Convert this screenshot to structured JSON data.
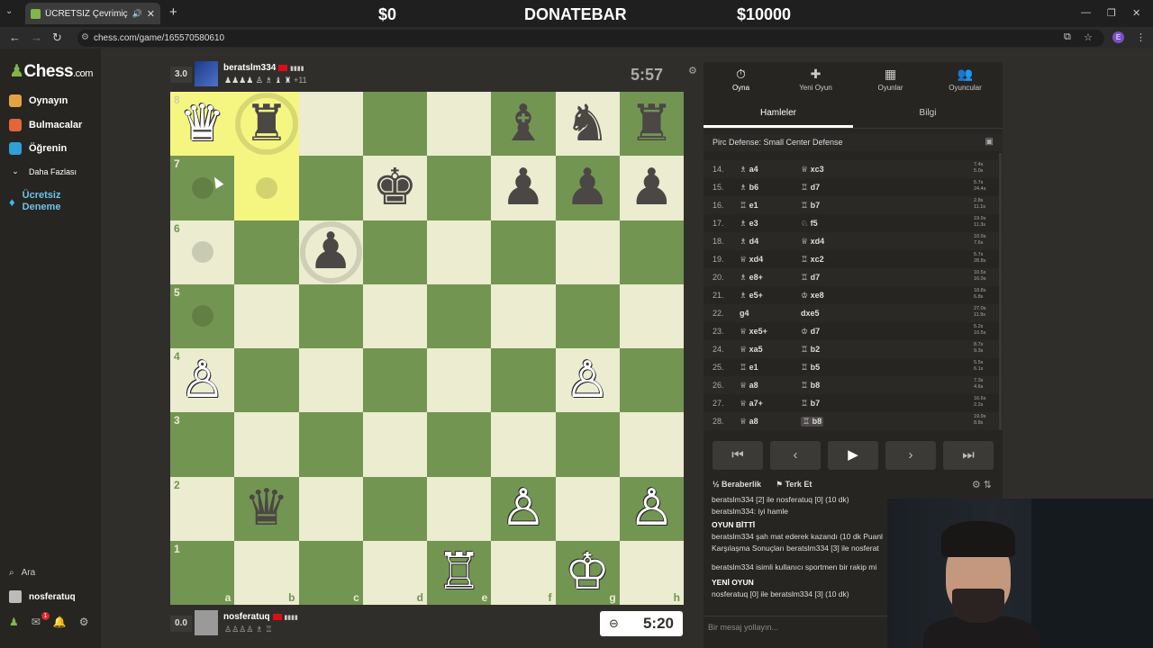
{
  "browser": {
    "tab_title": "ÜCRETSİZ Çevrimiçi Satranç",
    "url": "chess.com/game/165570580610",
    "donate_left": "$0",
    "donate_center": "DONATEBAR",
    "donate_right": "$10000",
    "profile_initial": "E"
  },
  "sidebar": {
    "logo": "Chess",
    "logo_suffix": ".com",
    "items": [
      {
        "label": "Oynayın",
        "color": "#e3a343"
      },
      {
        "label": "Bulmacalar",
        "color": "#e0673b"
      },
      {
        "label": "Öğrenin",
        "color": "#2f9fd8"
      }
    ],
    "more": "Daha Fazlası",
    "trial": "Ücretsiz Deneme",
    "search": "Ara",
    "username": "nosferatuq",
    "notifications": "1"
  },
  "top_player": {
    "score": "3.0",
    "name": "beratslm334",
    "status": "▮▮▮▮",
    "captured": "♟♟♟♟ ♙ ♗ ♝ ♜",
    "advantage": "+11",
    "clock": "5:57"
  },
  "bottom_player": {
    "score": "0.0",
    "name": "nosferatuq",
    "status": "▮▮▮▮",
    "captured": "♙♙♙♙ ♗ ♖",
    "clock": "5:20"
  },
  "board": {
    "ranks": [
      "8",
      "7",
      "6",
      "5",
      "4",
      "3",
      "2",
      "1"
    ],
    "files": [
      "a",
      "b",
      "c",
      "d",
      "e",
      "f",
      "g",
      "h"
    ],
    "rows": [
      [
        {
          "p": "♛",
          "c": "w",
          "hl": true
        },
        {
          "p": "♜",
          "c": "b",
          "hl": true,
          "ring": true
        },
        {},
        {},
        {},
        {
          "p": "♝",
          "c": "b"
        },
        {
          "p": "♞",
          "c": "b"
        },
        {
          "p": "♜",
          "c": "b"
        }
      ],
      [
        {
          "hint": true
        },
        {
          "hl": true,
          "hint": true
        },
        {},
        {
          "p": "♚",
          "c": "b"
        },
        {},
        {
          "p": "♟",
          "c": "b"
        },
        {
          "p": "♟",
          "c": "b"
        },
        {
          "p": "♟",
          "c": "b"
        }
      ],
      [
        {
          "hint": true
        },
        {},
        {
          "p": "♟",
          "c": "b",
          "ring": true
        },
        {},
        {},
        {},
        {},
        {}
      ],
      [
        {
          "hint": true
        },
        {},
        {},
        {},
        {},
        {},
        {},
        {}
      ],
      [
        {
          "p": "♙",
          "c": "w"
        },
        {},
        {},
        {},
        {},
        {},
        {
          "p": "♙",
          "c": "w"
        },
        {}
      ],
      [
        {},
        {},
        {},
        {},
        {},
        {},
        {},
        {}
      ],
      [
        {},
        {
          "p": "♛",
          "c": "b"
        },
        {},
        {},
        {},
        {
          "p": "♙",
          "c": "w"
        },
        {},
        {
          "p": "♙",
          "c": "w"
        }
      ],
      [
        {},
        {},
        {},
        {},
        {
          "p": "♖",
          "c": "w"
        },
        {},
        {
          "p": "♔",
          "c": "w"
        },
        {}
      ]
    ]
  },
  "panel": {
    "tabs": [
      {
        "label": "Oyna",
        "icon": "⏱"
      },
      {
        "label": "Yeni Oyun",
        "icon": "✚"
      },
      {
        "label": "Oyunlar",
        "icon": "▦"
      },
      {
        "label": "Oyuncular",
        "icon": "👥"
      }
    ],
    "subtabs": [
      "Hamleler",
      "Bilgi"
    ],
    "opening": "Pirc Defense: Small Center Defense",
    "moves": [
      {
        "n": "14.",
        "w": "♗ a4",
        "b": "♕ xc3",
        "t1": "7.4s",
        "t2": "5.0s"
      },
      {
        "n": "15.",
        "w": "♗ b6",
        "b": "♖ d7",
        "t1": "5.7s",
        "t2": "24.4s"
      },
      {
        "n": "16.",
        "w": "♖ e1",
        "b": "♖ b7",
        "t1": "2.8s",
        "t2": "11.1s"
      },
      {
        "n": "17.",
        "w": "♗ e3",
        "b": "♘ f5",
        "t1": "19.9s",
        "t2": "11.3s"
      },
      {
        "n": "18.",
        "w": "♗ d4",
        "b": "♕ xd4",
        "t1": "10.9s",
        "t2": "7.6s"
      },
      {
        "n": "19.",
        "w": "♕ xd4",
        "b": "♖ xc2",
        "t1": "5.7s",
        "t2": "28.8s"
      },
      {
        "n": "20.",
        "w": "♗ e8+",
        "b": "♖ d7",
        "t1": "10.5s",
        "t2": "16.0s"
      },
      {
        "n": "21.",
        "w": "♗ e5+",
        "b": "♔ xe8",
        "t1": "18.8s",
        "t2": "6.8s"
      },
      {
        "n": "22.",
        "w": "g4",
        "b": "dxe5",
        "t1": "27.0s",
        "t2": "11.9s"
      },
      {
        "n": "23.",
        "w": "♕ xe5+",
        "b": "♔ d7",
        "t1": "5.2s",
        "t2": "10.5s"
      },
      {
        "n": "24.",
        "w": "♕ xa5",
        "b": "♖ b2",
        "t1": "8.7s",
        "t2": "9.3s"
      },
      {
        "n": "25.",
        "w": "♖ e1",
        "b": "♖ b5",
        "t1": "5.5s",
        "t2": "6.1s"
      },
      {
        "n": "26.",
        "w": "♕ a8",
        "b": "♖ b8",
        "t1": "7.3s",
        "t2": "4.6s"
      },
      {
        "n": "27.",
        "w": "♕ a7+",
        "b": "♖ b7",
        "t1": "16.6s",
        "t2": "2.2s"
      },
      {
        "n": "28.",
        "w": "♕ a8",
        "b": "♖ b8",
        "t1": "19.9s",
        "t2": "8.8s"
      }
    ],
    "draw": "Beraberlik",
    "resign": "Terk Et",
    "chat": [
      "beratslm334 [2] ile nosferatuq [0] (10 dk)",
      "beratslm334: iyi hamle",
      "OYUN BİTTİ",
      "beratslm334 şah mat ederek kazandı (10 dk Puanl",
      "Karşılaşma Sonuçları beratslm334 [3] ile nosferat",
      "beratslm334 isimli kullanıcı sportmen bir rakip mi",
      "YENİ OYUN",
      "nosferatuq [0] ile beratslm334 [3] (10 dk)"
    ],
    "chat_placeholder": "Bir mesaj yollayın..."
  }
}
